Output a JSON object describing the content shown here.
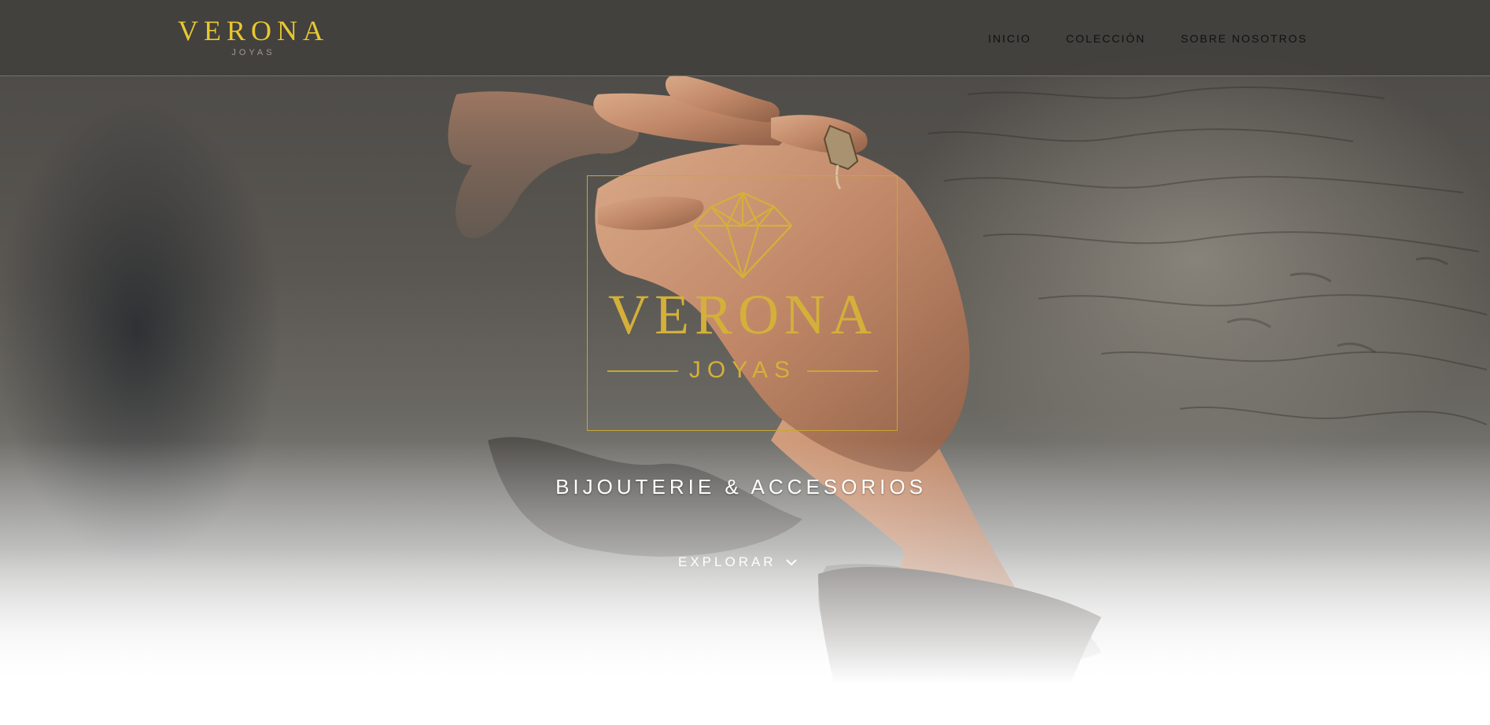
{
  "brand": {
    "name": "VERONA",
    "subtitle": "JOYAS",
    "gold_color": "#d4b03a",
    "nav_gold_color": "#e8c830"
  },
  "nav": {
    "items": [
      {
        "label": "INICIO"
      },
      {
        "label": "COLECCIÓN"
      },
      {
        "label": "SOBRE NOSOTROS"
      }
    ]
  },
  "hero": {
    "emblem_icon": "diamond-icon",
    "tagline": "BIJOUTERIE & ACCESORIOS",
    "explore_label": "EXPLORAR",
    "explore_icon": "chevron-down-icon"
  }
}
